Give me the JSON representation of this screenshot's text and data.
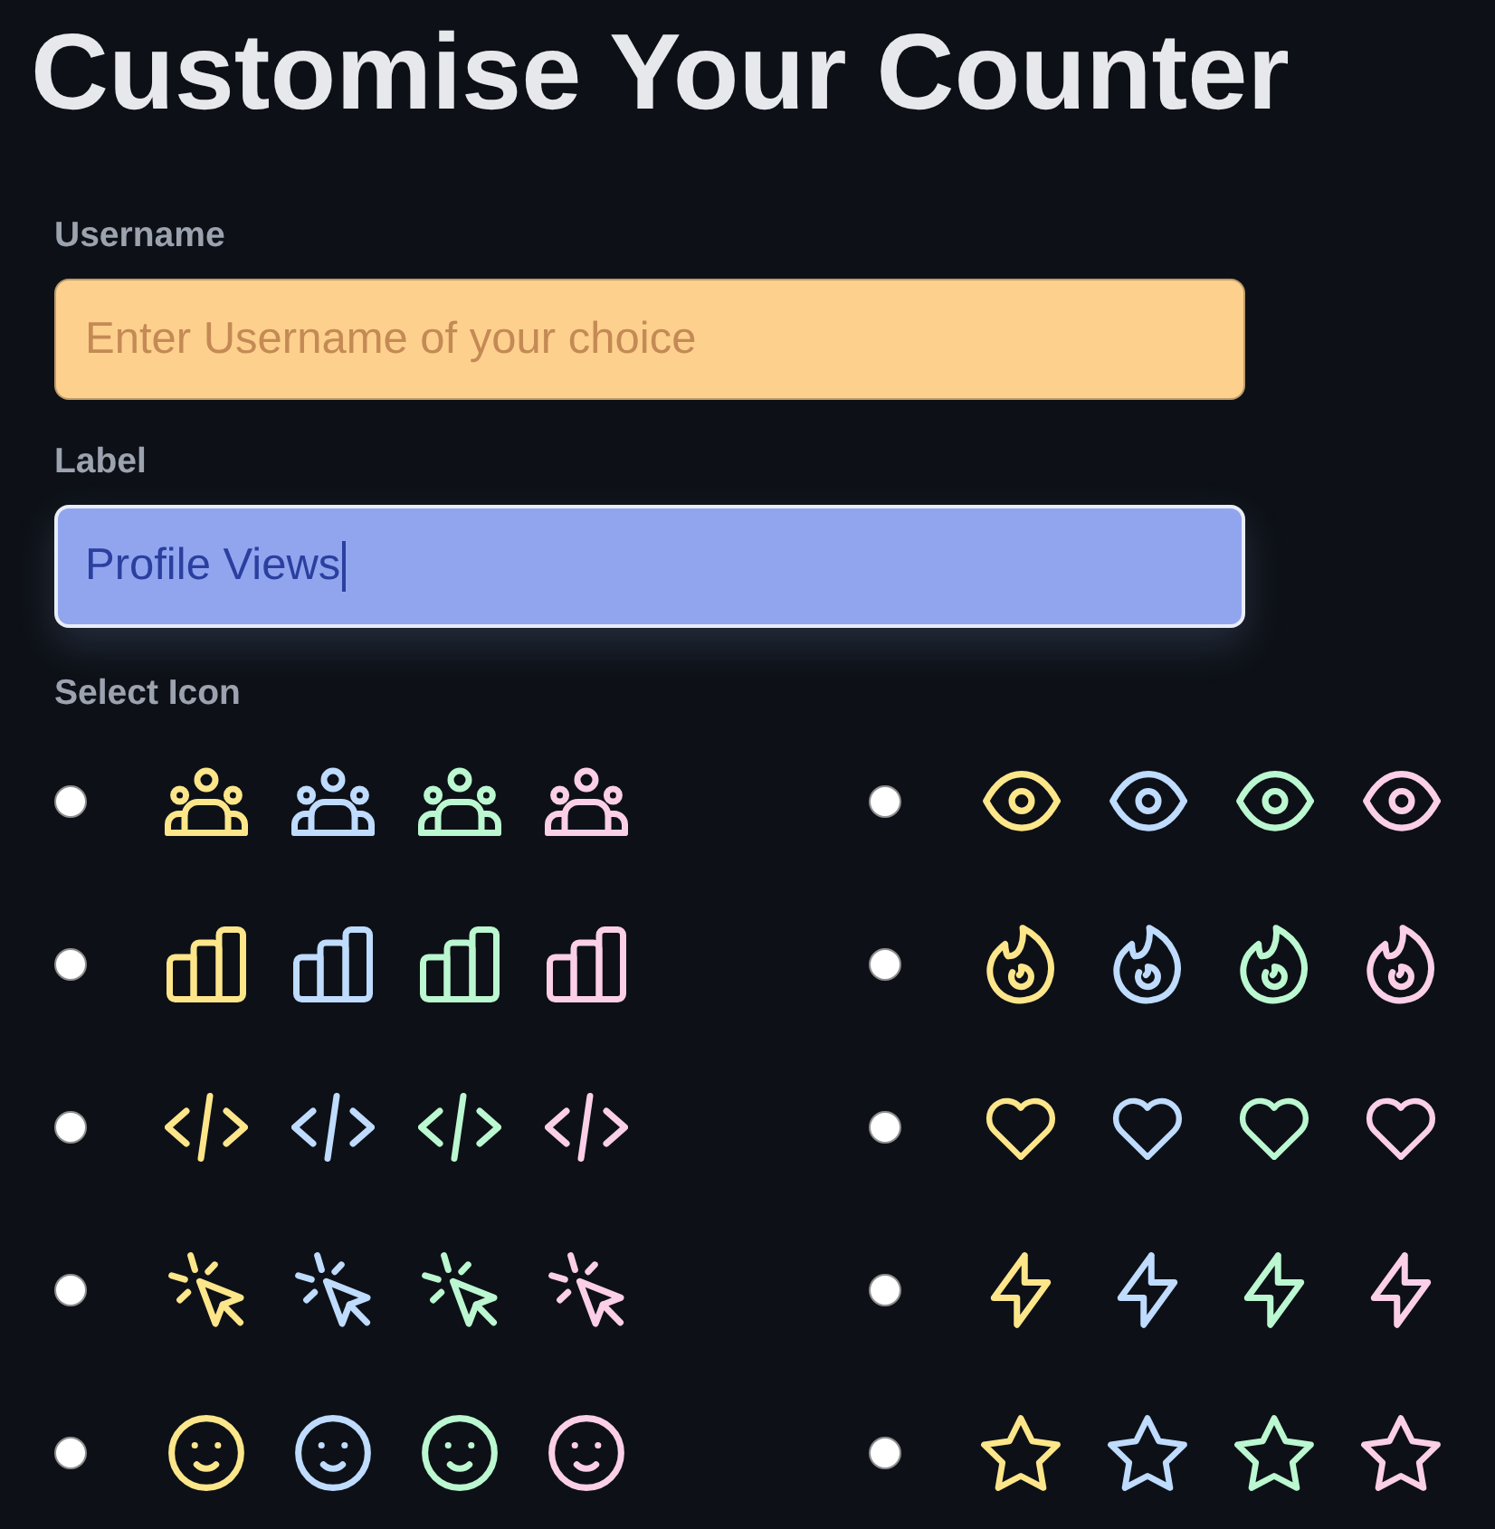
{
  "title": "Customise Your Counter",
  "fields": [
    {
      "label": "Username",
      "placeholder": "Enter Username of your choice",
      "color": "#fdd08e",
      "focused": false
    },
    {
      "label": "Label",
      "value": "Profile Views",
      "color": "#91a5ef",
      "focused": true
    }
  ],
  "icon_picker": {
    "label": "Select Icon",
    "options": [
      {
        "kind": "users",
        "selected": false,
        "variants": [
          {
            "color": "#fde68a"
          },
          {
            "color": "#bfdbfe"
          },
          {
            "color": "#bbf7d0"
          },
          {
            "color": "#fbcfe8"
          }
        ]
      },
      {
        "kind": "eye",
        "selected": false,
        "variants": [
          {
            "color": "#fde68a"
          },
          {
            "color": "#bfdbfe"
          },
          {
            "color": "#bbf7d0"
          },
          {
            "color": "#fbcfe8"
          }
        ]
      },
      {
        "kind": "chart",
        "selected": false,
        "variants": [
          {
            "color": "#fde68a"
          },
          {
            "color": "#bfdbfe"
          },
          {
            "color": "#bbf7d0"
          },
          {
            "color": "#fbcfe8"
          }
        ]
      },
      {
        "kind": "flame",
        "selected": false,
        "variants": [
          {
            "color": "#fde68a"
          },
          {
            "color": "#bfdbfe"
          },
          {
            "color": "#bbf7d0"
          },
          {
            "color": "#fbcfe8"
          }
        ]
      },
      {
        "kind": "code",
        "selected": false,
        "variants": [
          {
            "color": "#fde68a"
          },
          {
            "color": "#bfdbfe"
          },
          {
            "color": "#bbf7d0"
          },
          {
            "color": "#fbcfe8"
          }
        ]
      },
      {
        "kind": "heart",
        "selected": false,
        "variants": [
          {
            "color": "#fde68a"
          },
          {
            "color": "#bfdbfe"
          },
          {
            "color": "#bbf7d0"
          },
          {
            "color": "#fbcfe8"
          }
        ]
      },
      {
        "kind": "click",
        "selected": false,
        "variants": [
          {
            "color": "#fde68a"
          },
          {
            "color": "#bfdbfe"
          },
          {
            "color": "#bbf7d0"
          },
          {
            "color": "#fbcfe8"
          }
        ]
      },
      {
        "kind": "bolt",
        "selected": false,
        "variants": [
          {
            "color": "#fde68a"
          },
          {
            "color": "#bfdbfe"
          },
          {
            "color": "#bbf7d0"
          },
          {
            "color": "#fbcfe8"
          }
        ]
      },
      {
        "kind": "smile",
        "selected": false,
        "variants": [
          {
            "color": "#fde68a"
          },
          {
            "color": "#bfdbfe"
          },
          {
            "color": "#bbf7d0"
          },
          {
            "color": "#fbcfe8"
          }
        ]
      },
      {
        "kind": "star",
        "selected": false,
        "variants": [
          {
            "color": "#fde68a"
          },
          {
            "color": "#bfdbfe"
          },
          {
            "color": "#bbf7d0"
          },
          {
            "color": "#fbcfe8"
          }
        ]
      }
    ]
  }
}
